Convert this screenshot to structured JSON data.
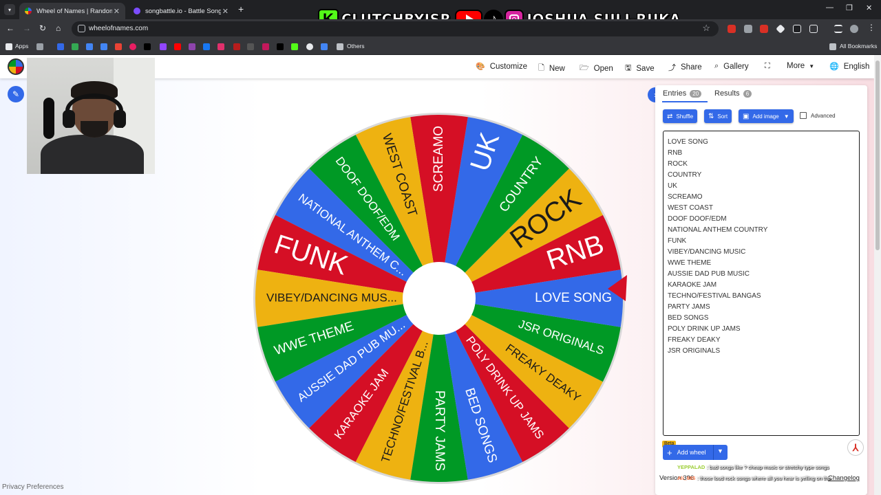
{
  "browser": {
    "tabs": [
      {
        "title": "Wheel of Names | Random nam",
        "active": true
      },
      {
        "title": "songbattle.io - Battle Songs ag",
        "active": false
      }
    ],
    "url": "wheelofnames.com",
    "bookmarks": {
      "apps": "Apps",
      "others": "Others",
      "all_bookmarks": "All Bookmarks"
    }
  },
  "overlay": {
    "kick_letter": "K",
    "kick_name": "CLUTCHBYJSR",
    "tiktok_glyph": "♪",
    "social_name": "JOSHUA SULI-RUKA"
  },
  "menu": {
    "customize": "Customize",
    "new": "New",
    "open": "Open",
    "save": "Save",
    "share": "Share",
    "gallery": "Gallery",
    "more": "More",
    "language": "English"
  },
  "wheel": {
    "segments": [
      {
        "label": "RNB",
        "color": "#d50f25"
      },
      {
        "label": "ROCK",
        "color": "#eeb211"
      },
      {
        "label": "COUNTRY",
        "color": "#009925"
      },
      {
        "label": "UK",
        "color": "#3369e8"
      },
      {
        "label": "SCREAMO",
        "color": "#d50f25"
      },
      {
        "label": "WEST COAST",
        "color": "#eeb211"
      },
      {
        "label": "DOOF DOOF/EDM",
        "color": "#009925"
      },
      {
        "label": "NATIONAL ANTHEM C...",
        "color": "#3369e8"
      },
      {
        "label": "FUNK",
        "color": "#d50f25"
      },
      {
        "label": "VIBEY/DANCING MUS...",
        "color": "#eeb211"
      },
      {
        "label": "WWE THEME",
        "color": "#009925"
      },
      {
        "label": "AUSSIE DAD PUB MU...",
        "color": "#3369e8"
      },
      {
        "label": "KARAOKE JAM",
        "color": "#d50f25"
      },
      {
        "label": "TECHNO/FESTIVAL B...",
        "color": "#eeb211"
      },
      {
        "label": "PARTY JAMS",
        "color": "#009925"
      },
      {
        "label": "BED SONGS",
        "color": "#3369e8"
      },
      {
        "label": "POLY DRINK UP JAMS",
        "color": "#d50f25"
      },
      {
        "label": "FREAKY DEAKY",
        "color": "#eeb211"
      },
      {
        "label": "JSR ORIGINALS",
        "color": "#009925"
      },
      {
        "label": "LOVE SONG",
        "color": "#3369e8"
      }
    ]
  },
  "panel": {
    "tab_entries": "Entries",
    "entries_count": "20",
    "tab_results": "Results",
    "results_count": "6",
    "shuffle": "Shuffle",
    "sort": "Sort",
    "add_image": "Add image",
    "advanced": "Advanced",
    "entries": [
      "LOVE SONG",
      "RNB",
      "ROCK",
      "COUNTRY",
      "UK",
      "SCREAMO",
      "WEST COAST",
      "DOOF DOOF/EDM",
      "NATIONAL ANTHEM COUNTRY",
      "FUNK",
      "VIBEY/DANCING MUSIC",
      "WWE THEME",
      "AUSSIE DAD PUB MUSIC",
      "KARAOKE JAM",
      "TECHNO/FESTIVAL BANGAS",
      "PARTY JAMS",
      "BED SONGS",
      "POLY DRINK UP JAMS",
      "FREAKY DEAKY",
      "JSR ORIGINALS"
    ],
    "beta": "Beta",
    "add_wheel": "Add wheel",
    "version": "Version 396",
    "changelog": "Changelog"
  },
  "chat": [
    {
      "user": "YEPPALAD",
      "message": ": bad songs like ? cheap music or stretchy type songs",
      "color": "#9acd32"
    },
    {
      "user": "Ali_685",
      "message": ": those loud rock songs where all you hear is yelling on the",
      "color": "#ff7f50"
    }
  ],
  "footer": {
    "privacy": "Privacy Preferences"
  }
}
